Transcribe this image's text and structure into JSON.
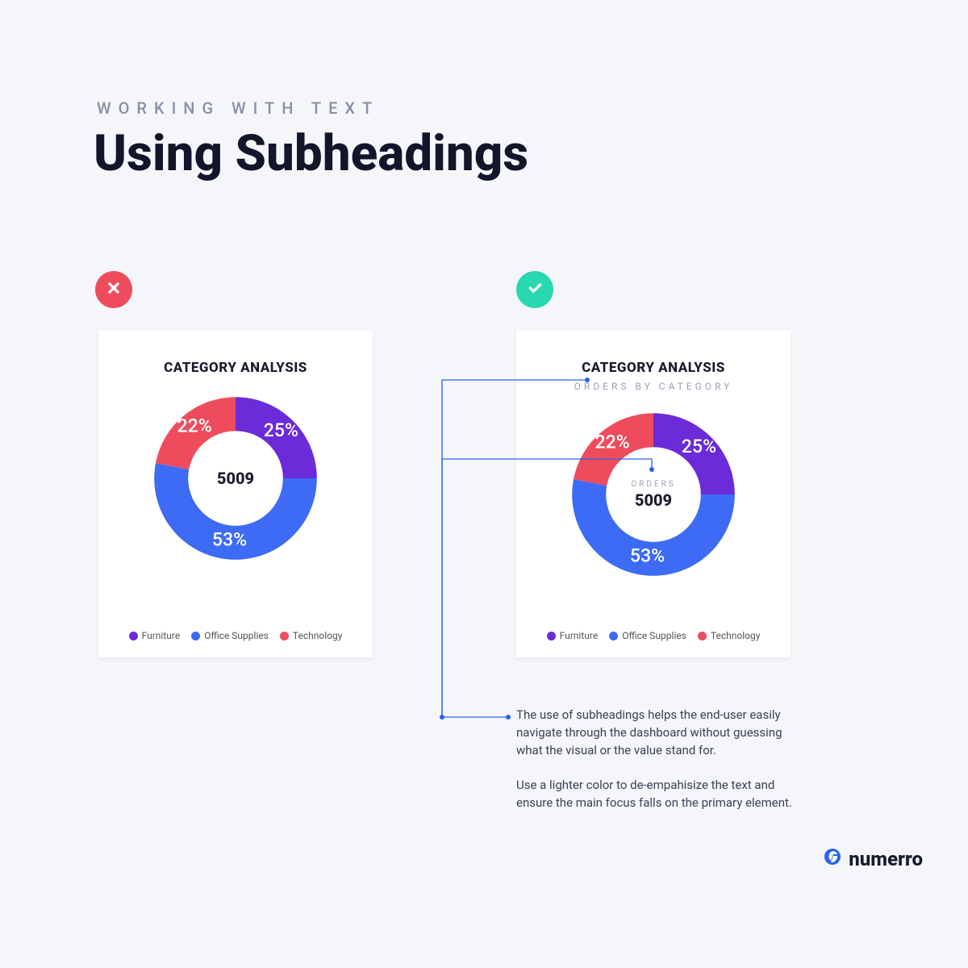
{
  "eyebrow": "WORKING WITH TEXT",
  "title": "Using Subheadings",
  "cards": {
    "bad": {
      "heading": "CATEGORY ANALYSIS",
      "center_value": "5009"
    },
    "good": {
      "heading": "CATEGORY ANALYSIS",
      "subheading": "ORDERS BY CATEGORY",
      "center_label": "ORDERS",
      "center_value": "5009"
    }
  },
  "chart_data": [
    {
      "type": "pie",
      "title": "CATEGORY ANALYSIS",
      "donut": true,
      "center_value": 5009,
      "series": [
        {
          "name": "Furniture",
          "value": 25,
          "label": "25%",
          "color": "#6b2bd9"
        },
        {
          "name": "Office Supplies",
          "value": 53,
          "label": "53%",
          "color": "#3d6bf5"
        },
        {
          "name": "Technology",
          "value": 22,
          "label": "22%",
          "color": "#ee4c5d"
        }
      ]
    },
    {
      "type": "pie",
      "title": "CATEGORY ANALYSIS",
      "subtitle": "ORDERS BY CATEGORY",
      "donut": true,
      "center_label": "ORDERS",
      "center_value": 5009,
      "series": [
        {
          "name": "Furniture",
          "value": 25,
          "label": "25%",
          "color": "#6b2bd9"
        },
        {
          "name": "Office Supplies",
          "value": 53,
          "label": "53%",
          "color": "#3d6bf5"
        },
        {
          "name": "Technology",
          "value": 22,
          "label": "22%",
          "color": "#ee4c5d"
        }
      ]
    }
  ],
  "legend": {
    "items": [
      "Furniture",
      "Office Supplies",
      "Technology"
    ]
  },
  "explain": {
    "p1": "The use of subheadings helps the end-user easily navigate through the dashboard without guessing what the visual or the value stand for.",
    "p2": "Use a lighter color to de-empahisize the text and ensure the main focus falls on the primary element."
  },
  "brand": "numerro",
  "colors": {
    "furniture": "#6b2bd9",
    "office_supplies": "#3d6bf5",
    "technology": "#ee4c5d",
    "good": "#29d8b0",
    "bad": "#ee4c5d",
    "accent": "#2a63e8"
  }
}
